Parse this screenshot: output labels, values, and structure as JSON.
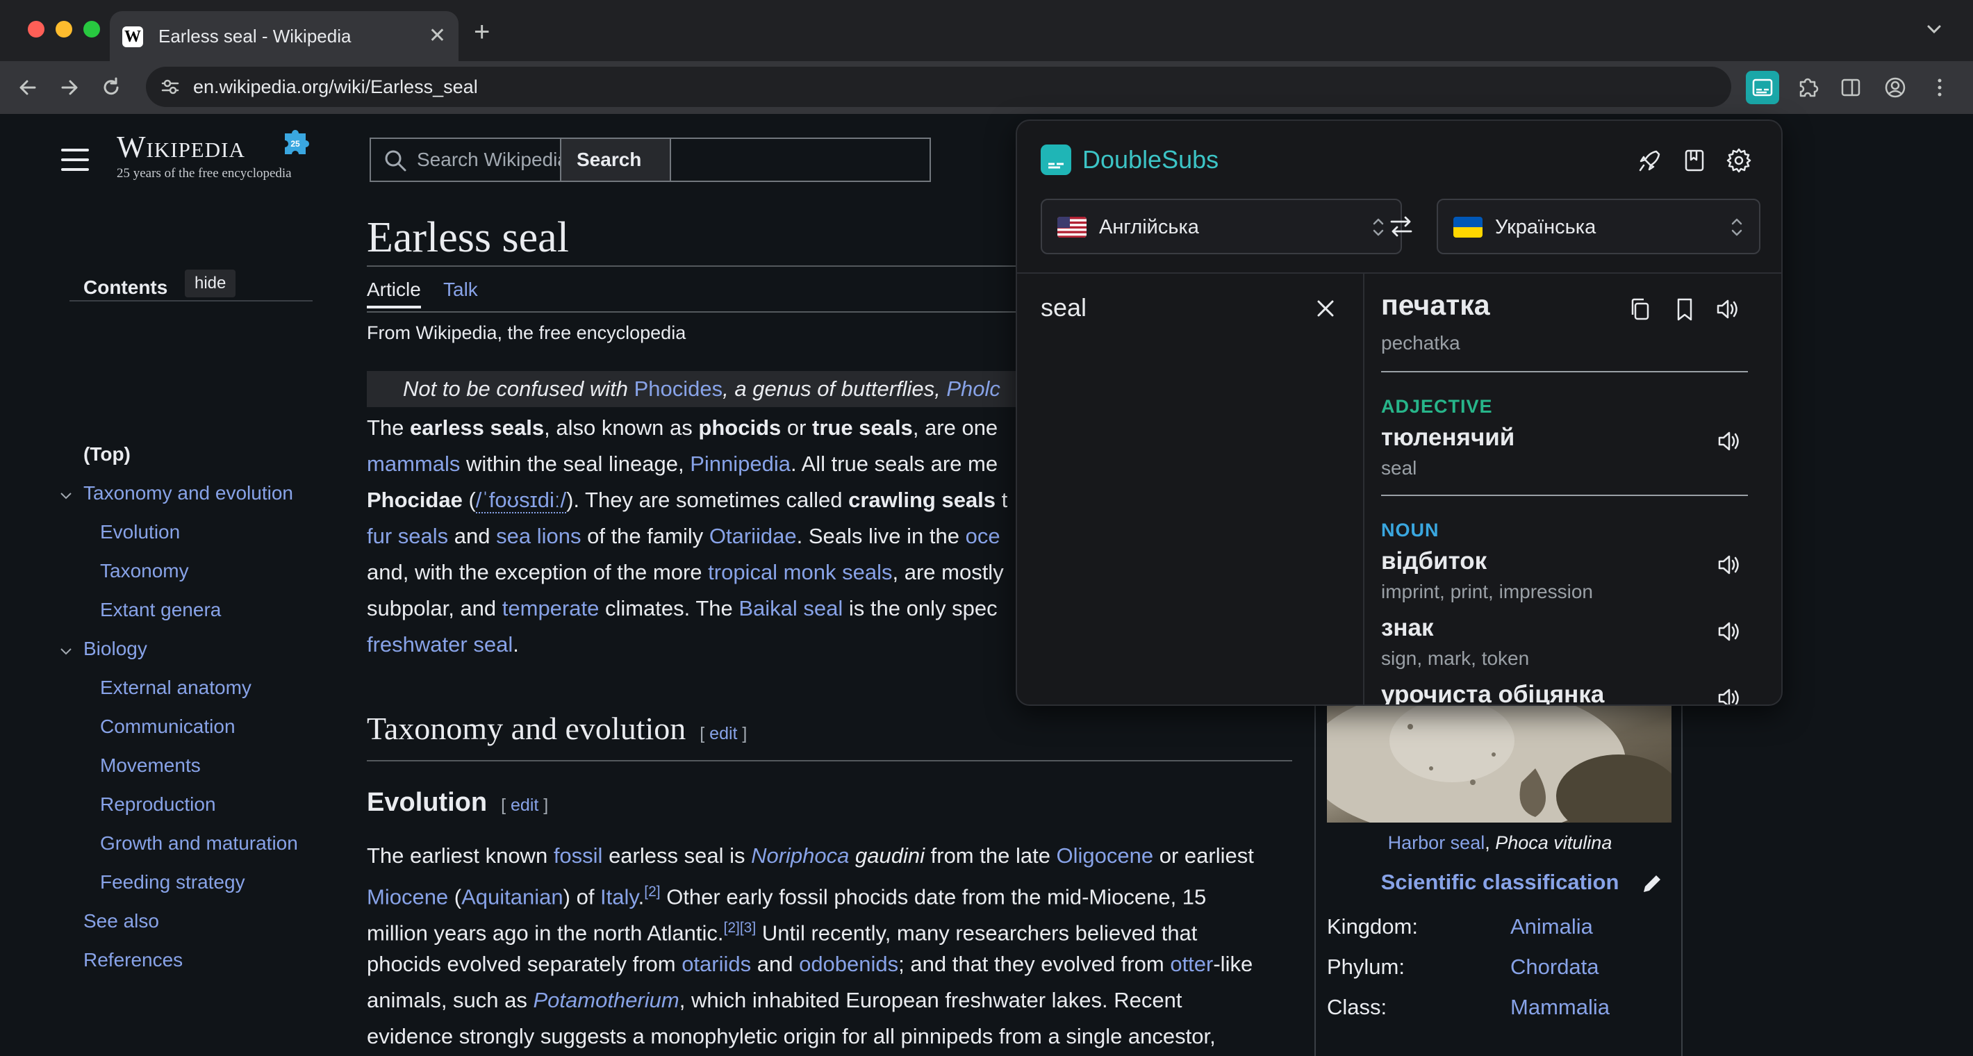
{
  "browser": {
    "tab_title": "Earless seal - Wikipedia",
    "url": "en.wikipedia.org/wiki/Earless_seal"
  },
  "wiki": {
    "logo_wordmark": "Wikipedia",
    "tagline": "25 years of the free encyclopedia",
    "search_placeholder": "Search Wikipedia",
    "search_button": "Search"
  },
  "toc": {
    "title": "Contents",
    "hide": "hide",
    "items": [
      {
        "label": "(Top)"
      },
      {
        "label": "Taxonomy and evolution"
      },
      {
        "label": "Evolution"
      },
      {
        "label": "Taxonomy"
      },
      {
        "label": "Extant genera"
      },
      {
        "label": "Biology"
      },
      {
        "label": "External anatomy"
      },
      {
        "label": "Communication"
      },
      {
        "label": "Movements"
      },
      {
        "label": "Reproduction"
      },
      {
        "label": "Growth and maturation"
      },
      {
        "label": "Feeding strategy"
      },
      {
        "label": "See also"
      },
      {
        "label": "References"
      }
    ]
  },
  "article": {
    "title": "Earless seal",
    "tab_article": "Article",
    "tab_talk": "Talk",
    "from": "From Wikipedia, the free encyclopedia",
    "hatnote": {
      "t1": "Not to be confused with ",
      "l1": "Phocides",
      "t2": ", a genus of butterflies, ",
      "l2": "Pholc"
    },
    "lead": {
      "l1": {
        "t1": "The ",
        "b1": "earless seals",
        "t2": ", also known as ",
        "b2": "phocids",
        "t3": " or ",
        "b3": "true seals",
        "t4": ", are one"
      },
      "l2": {
        "a1": "mammals",
        "t1": " within the seal lineage, ",
        "a2": "Pinnipedia",
        "t2": ". All true seals are me"
      },
      "l3": {
        "b1": "Phocidae",
        "t1": " (",
        "ipa": "/ˈfoʊsɪdiː/",
        "t2": "). They are sometimes called ",
        "b2": "crawling seals",
        "t3": " t"
      },
      "l4": {
        "a1": "fur seals",
        "t1": " and ",
        "a2": "sea lions",
        "t2": " of the family ",
        "a3": "Otariidae",
        "t3": ". Seals live in the ",
        "a4": "oce"
      },
      "l5": {
        "t1": "and, with the exception of the more ",
        "a1": "tropical monk seals",
        "t2": ", are mostly"
      },
      "l6": {
        "t1": "subpolar, and ",
        "a1": "temperate",
        "t2": " climates. The ",
        "a2": "Baikal seal",
        "t3": " is the only spec"
      },
      "l7": {
        "a1": "freshwater seal",
        "t1": "."
      }
    },
    "h2": "Taxonomy and evolution",
    "h3": "Evolution",
    "edit": "edit",
    "evo": {
      "l1": {
        "t1": "The earliest known ",
        "a1": "fossil",
        "t2": " earless seal is ",
        "i1": "Noriphoca",
        "t3": " ",
        "i2": "gaudini",
        "t4": " from the late ",
        "a2": "Oligocene",
        "t5": " or earliest"
      },
      "l2": {
        "a1": "Miocene",
        "t1": " (",
        "a2": "Aquitanian",
        "t2": ") of ",
        "a3": "Italy",
        "t3": ".",
        "s1": "[2]",
        "t4": " Other early fossil phocids date from the mid-Miocene, 15"
      },
      "l3": {
        "t1": "million years ago in the north Atlantic.",
        "s1": "[2][3]",
        "t2": " Until recently, many researchers believed that"
      },
      "l4": {
        "t1": "phocids evolved separately from ",
        "a1": "otariids",
        "t2": " and ",
        "a2": "odobenids",
        "t3": "; and that they evolved from ",
        "a3": "otter",
        "t4": "-like"
      },
      "l5": {
        "t1": "animals, such as ",
        "a1": "Potamotherium",
        "t2": ", which inhabited European freshwater lakes. Recent"
      },
      "l6": {
        "t1": "evidence strongly suggests a monophyletic origin for all pinnipeds from a single ancestor,"
      }
    }
  },
  "infobox": {
    "caption_link": "Harbor seal",
    "caption_sep": ", ",
    "caption_italic": "Phoca vitulina",
    "sci_title": "Scientific classification",
    "rows": [
      {
        "label": "Kingdom:",
        "value": "Animalia"
      },
      {
        "label": "Phylum:",
        "value": "Chordata"
      },
      {
        "label": "Class:",
        "value": "Mammalia"
      }
    ]
  },
  "popup": {
    "name": "DoubleSubs",
    "source_lang": "Англійська",
    "target_lang": "Українська",
    "source_text": "seal",
    "result_word": "печатка",
    "result_translit": "pechatka",
    "groups": [
      {
        "pos": "ADJECTIVE",
        "color": "#27b58a",
        "entries": [
          {
            "word": "тюленячий",
            "gloss": "seal"
          }
        ]
      },
      {
        "pos": "NOUN",
        "color": "#3aa7e0",
        "entries": [
          {
            "word": "відбиток",
            "gloss": "imprint, print, impression"
          },
          {
            "word": "знак",
            "gloss": "sign, mark, token"
          },
          {
            "word": "урочиста обіцянка",
            "gloss": ""
          }
        ]
      }
    ]
  }
}
